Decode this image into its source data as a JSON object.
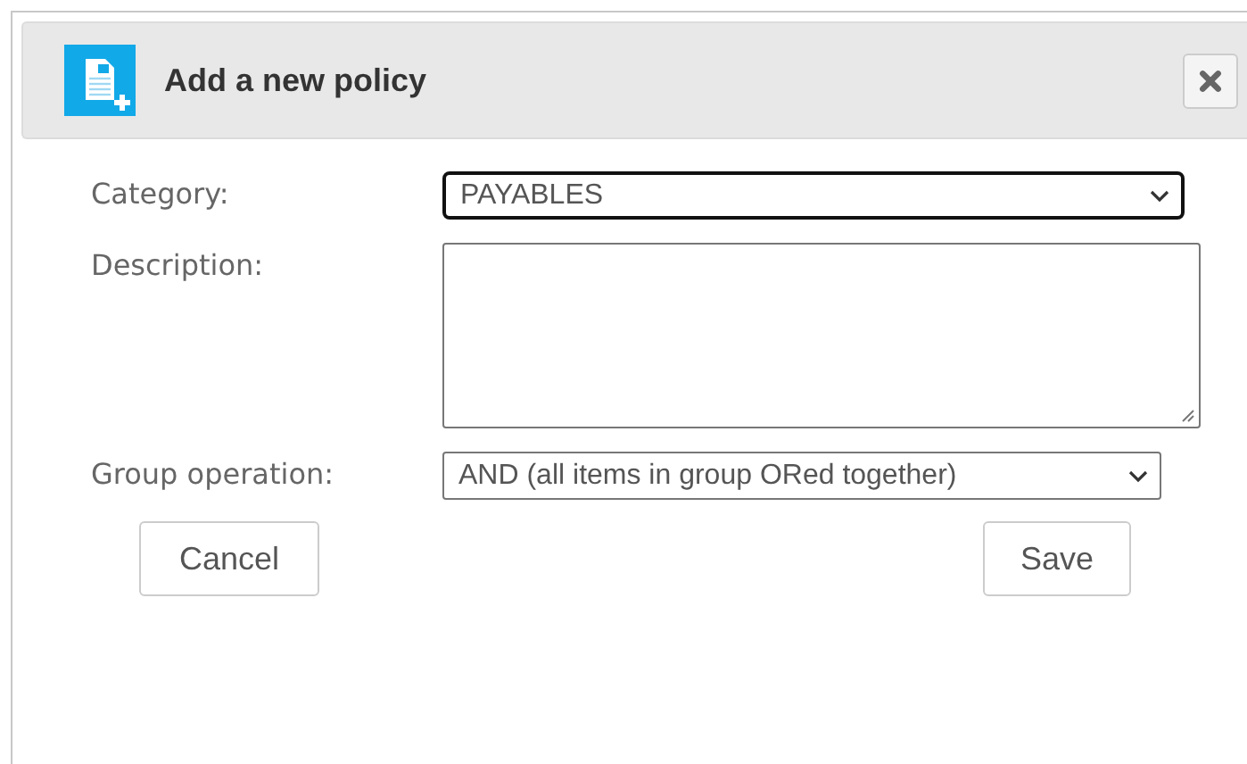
{
  "dialog": {
    "title": "Add a new policy"
  },
  "fields": [
    {
      "kind": "select",
      "label": "Category:",
      "value": "PAYABLES",
      "focused": true
    },
    {
      "kind": "textarea",
      "label": "Description:",
      "focused": false
    },
    {
      "kind": "select",
      "label": "Group operation:",
      "value": "AND (all items in group ORed together)",
      "focused": false
    }
  ],
  "buttons": [
    {
      "label": "Cancel",
      "kind": "cancel"
    },
    {
      "label": "Save",
      "kind": "save"
    }
  ]
}
